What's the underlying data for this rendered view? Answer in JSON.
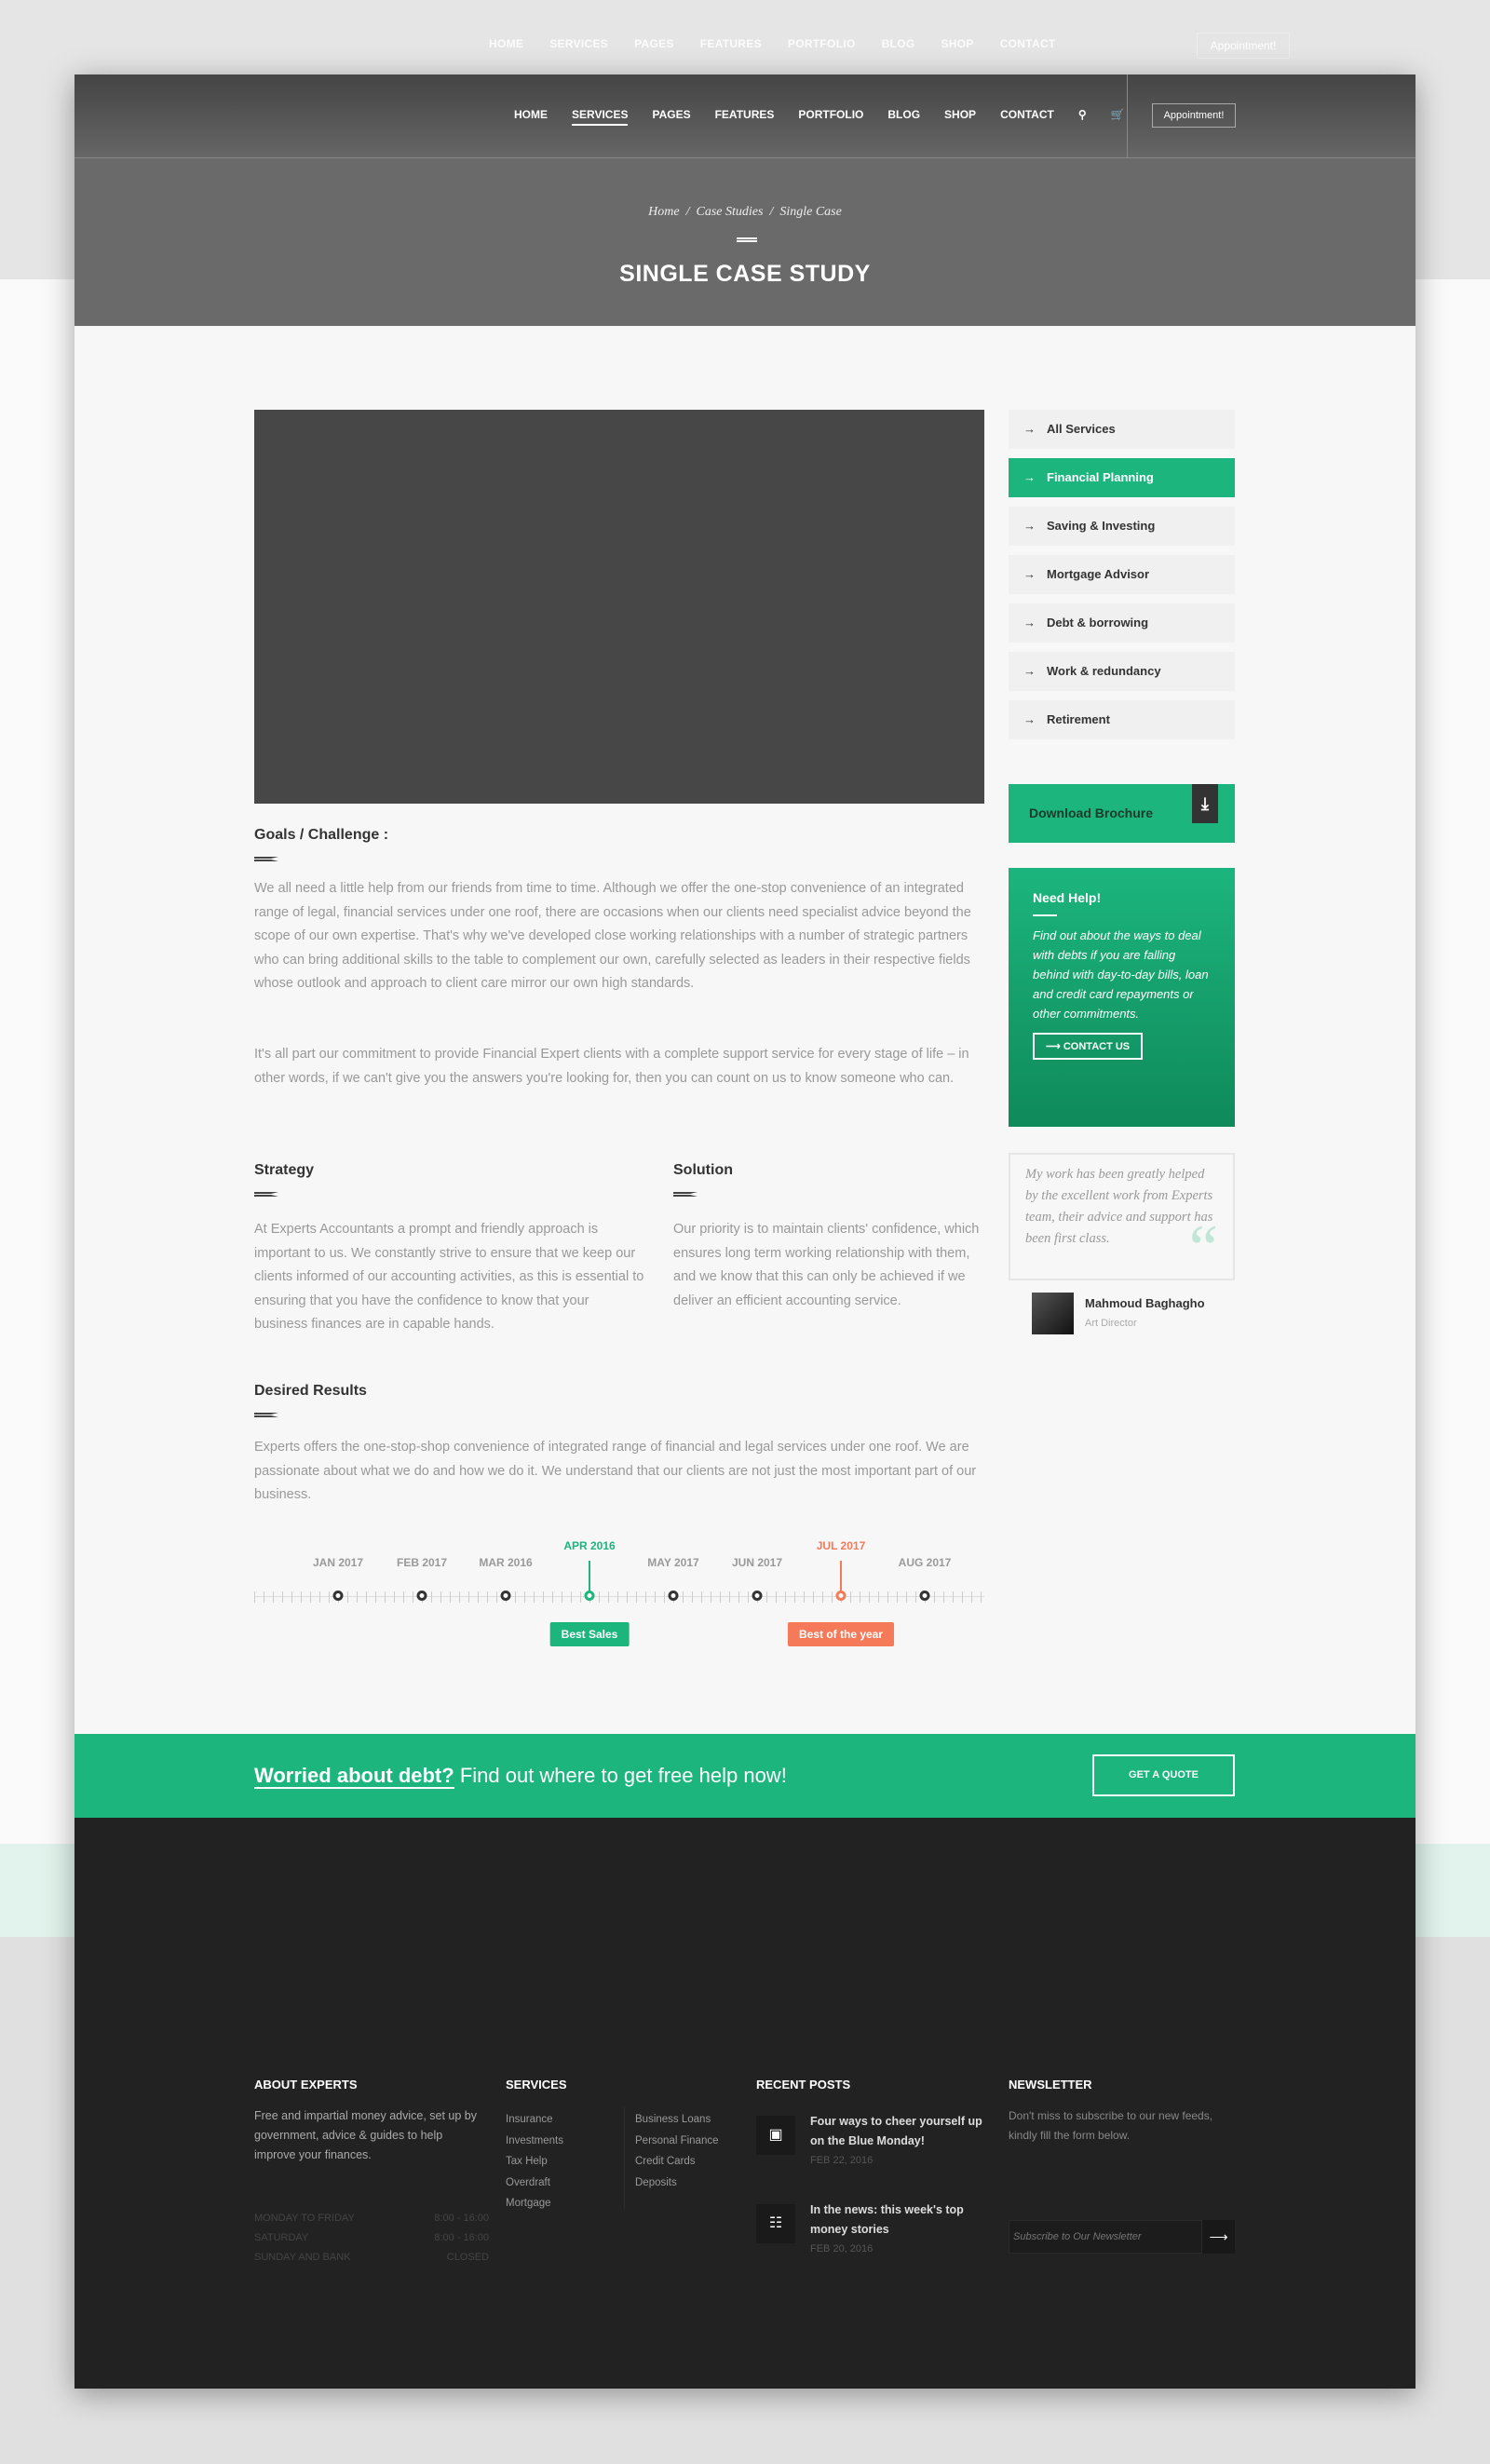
{
  "nav": {
    "items": [
      "HOME",
      "SERVICES",
      "PAGES",
      "FEATURES",
      "PORTFOLIO",
      "BLOG",
      "SHOP",
      "CONTACT"
    ],
    "active": "SERVICES",
    "appointment_label": "Appointment!"
  },
  "hero": {
    "breadcrumb": [
      "Home",
      "Case Studies",
      "Single Case"
    ],
    "title": "SINGLE CASE STUDY"
  },
  "content": {
    "goals_heading": "Goals / Challenge :",
    "goals_p1": "We all need a little help from our friends from time to time. Although we offer the one-stop convenience of an integrated range of legal, financial services under one roof, there are occasions when our clients need specialist advice beyond the scope of our own expertise. That's why we've developed close working relationships with a number of strategic partners who can bring additional skills to the table to complement our own, carefully selected as leaders in their respective fields whose outlook and approach to client care mirror our own high standards.",
    "goals_p2": "It's all part our commitment to provide Financial Expert clients with a complete support service for every stage of life – in other words, if we can't give you the answers you're looking for, then you can count on us to know someone who can.",
    "strategy_heading": "Strategy",
    "strategy_text": "At Experts Accountants a prompt and friendly approach is important to us. We constantly strive to ensure that we keep our clients informed of our accounting activities, as this is essential to ensuring that you have the confidence to know that your business finances are in capable hands.",
    "solution_heading": "Solution",
    "solution_text": "Our priority is to maintain clients' confidence, which ensures long term working relationship with them, and we know that this can only be achieved if we deliver an efficient accounting service.",
    "results_heading": "Desired Results",
    "results_text": "Experts offers the one-stop-shop convenience of integrated range of financial and legal services under one roof. We are passionate about what we do and how we do it. We understand that our clients are not just the most important part of our business."
  },
  "timeline": {
    "points": [
      {
        "label": "JAN 2017"
      },
      {
        "label": "FEB 2017"
      },
      {
        "label": "MAR 2016"
      },
      {
        "label": "APR 2016",
        "highlight": "green",
        "tag": "Best Sales"
      },
      {
        "label": "MAY 2017"
      },
      {
        "label": "JUN 2017"
      },
      {
        "label": "JUL 2017",
        "highlight": "orange",
        "tag": "Best of the year"
      },
      {
        "label": "AUG 2017"
      }
    ],
    "colors": {
      "green": "#1cb57e",
      "orange": "#f47a5a"
    }
  },
  "sidebar": {
    "items": [
      "All Services",
      "Financial Planning",
      "Saving & Investing",
      "Mortgage Advisor",
      "Debt & borrowing",
      "Work & redundancy",
      "Retirement"
    ],
    "active_index": 1,
    "brochure_label": "Download Brochure",
    "help": {
      "title": "Need Help!",
      "text": "Find out about the ways to deal with debts if you are falling behind with day-to-day bills, loan and credit card repayments or other commitments.",
      "button": "CONTACT US"
    },
    "testimonial": {
      "quote": "My work has been greatly helped by the excellent work from Experts team, their advice and support has been first class.",
      "author": "Mahmoud Baghagho",
      "role": "Art Director"
    }
  },
  "cta": {
    "highlight": "Worried about debt?",
    "text": " Find out where to get free help now!",
    "button": "GET A QUOTE"
  },
  "footer": {
    "about": {
      "heading": "ABOUT EXPERTS",
      "text": "Free and impartial money advice, set up by government, advice & guides to help improve your finances.",
      "hours": [
        {
          "day": "MONDAY TO FRIDAY",
          "time": "8:00 - 16:00"
        },
        {
          "day": "SATURDAY",
          "time": "8:00 - 16:00"
        },
        {
          "day": "SUNDAY AND BANK",
          "time": "CLOSED"
        }
      ]
    },
    "services": {
      "heading": "SERVICES",
      "col1": [
        "Insurance",
        "Investments",
        "Tax Help",
        "Overdraft",
        "Mortgage"
      ],
      "col2": [
        "Business Loans",
        "Personal Finance",
        "Credit Cards",
        "Deposits"
      ]
    },
    "posts": {
      "heading": "RECENT POSTS",
      "items": [
        {
          "title": "Four ways to cheer yourself up on the Blue Monday!",
          "date": "FEB 22, 2016",
          "icon": "image-icon"
        },
        {
          "title": "In the news: this week's top money stories",
          "date": "FEB 20, 2016",
          "icon": "document-icon"
        }
      ]
    },
    "newsletter": {
      "heading": "NEWSLETTER",
      "text": "Don't miss to subscribe to our new feeds, kindly fill the form below.",
      "placeholder": "Subscribe to Our Newsletter"
    }
  },
  "colors": {
    "accent": "#1cb57e",
    "footer": "#222222",
    "hero": "#6a6a6a"
  }
}
